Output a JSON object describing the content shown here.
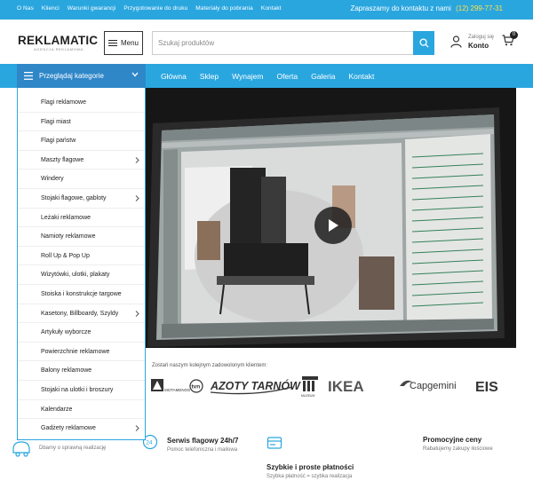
{
  "topbar": {
    "links": [
      "O Nas",
      "Klienci",
      "Warunki gwarancji",
      "Przygotowanie do druku",
      "Materiały do pobrania",
      "Kontakt"
    ],
    "contact_text": "Zapraszamy do kontaktu z nami",
    "phone": "(12) 299-77-31"
  },
  "header": {
    "logo": "REKLAMATIC",
    "logo_tagline": "AGENCJA REKLAMOWA",
    "menu_label": "Menu",
    "search_placeholder": "Szukaj produktów",
    "account_line1": "Zaloguj się",
    "account_line2": "Konto",
    "cart_count": "0"
  },
  "nav": {
    "categories_label": "Przeglądaj kategorie",
    "links": [
      "Główna",
      "Sklep",
      "Wynajem",
      "Oferta",
      "Galeria",
      "Kontakt"
    ]
  },
  "categories": [
    {
      "label": "Flagi reklamowe",
      "sub": false
    },
    {
      "label": "Flagi miast",
      "sub": false
    },
    {
      "label": "Flagi państw",
      "sub": false
    },
    {
      "label": "Maszty flagowe",
      "sub": true
    },
    {
      "label": "Windery",
      "sub": false
    },
    {
      "label": "Stojaki flagowe, gabloty",
      "sub": true
    },
    {
      "label": "Leżaki reklamowe",
      "sub": false
    },
    {
      "label": "Namioty reklamowe",
      "sub": false
    },
    {
      "label": "Roll Up & Pop Up",
      "sub": false
    },
    {
      "label": "Wizytówki, ulotki, plakaty",
      "sub": false
    },
    {
      "label": "Stoiska i konstrukcje targowe",
      "sub": false
    },
    {
      "label": "Kasetony, Billboardy, Szyldy",
      "sub": true
    },
    {
      "label": "Artykuły wyborcze",
      "sub": false
    },
    {
      "label": "Powierzchnie reklamowe",
      "sub": false
    },
    {
      "label": "Balony reklamowe",
      "sub": false
    },
    {
      "label": "Stojaki na ulotki i broszury",
      "sub": false
    },
    {
      "label": "Kalendarze",
      "sub": false
    },
    {
      "label": "Gadżety reklamowe",
      "sub": true
    }
  ],
  "clients": {
    "label": "Zostań naszym kolejnym zadowolonym klientem:",
    "logos": [
      "MOTAMENOS",
      "tvn",
      "AZOTY TARNÓW",
      "MUZEUM",
      "IKEA",
      "Capgemini",
      "EIS"
    ]
  },
  "features": [
    {
      "title": "",
      "subtitle": "Dbamy o sprawną realizację",
      "icon": "shipping-icon"
    },
    {
      "title": "Serwis flagowy 24h/7",
      "subtitle": "Pomoc telefoniczna i mailowa",
      "icon": "clock-24-icon"
    },
    {
      "title": "Szybkie i proste płatności",
      "subtitle": "Szybka płatność = szybka realizacja",
      "icon": "payment-icon"
    },
    {
      "title": "Promocyjne ceny",
      "subtitle": "Rabatujemy zakupy ilościowe",
      "icon": "discount-icon"
    }
  ],
  "colors": {
    "primary": "#2aa6df",
    "primary_dark": "#2f87c8",
    "phone_accent": "#ffe04a"
  }
}
